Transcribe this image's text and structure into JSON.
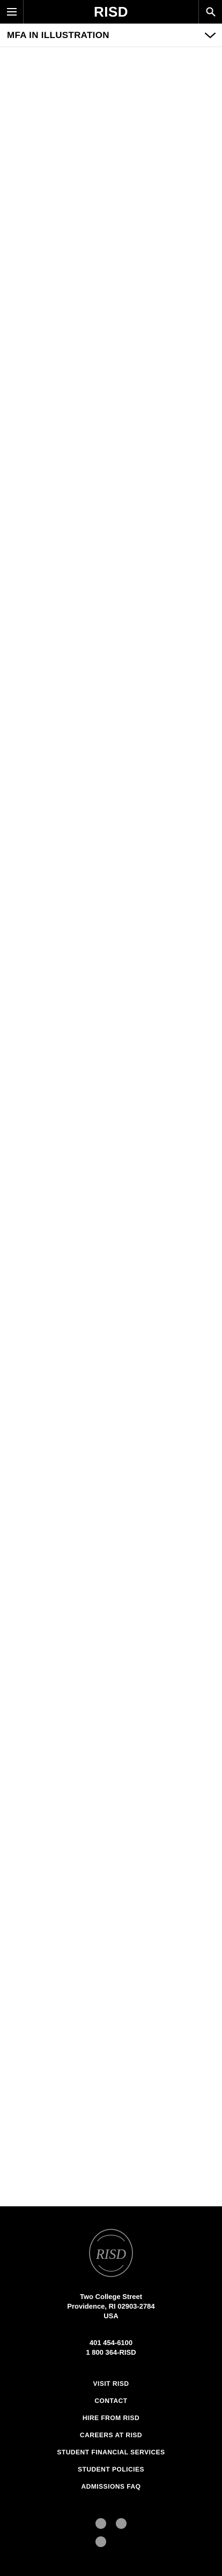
{
  "header": {
    "logo": "RISD",
    "menu_icon": "hamburger-menu-icon",
    "search_icon": "search-icon"
  },
  "subnav": {
    "title": "MFA IN ILLUSTRATION",
    "toggle_icon": "chevron-down-icon"
  },
  "footer": {
    "seal_text": "RISD",
    "address": {
      "line1": "Two College Street",
      "line2": "Providence, RI 02903-2784",
      "line3": "USA"
    },
    "phone1": "401 454-6100",
    "phone2": "1 800 364-RISD",
    "links": [
      {
        "label": "VISIT RISD"
      },
      {
        "label": "CONTACT"
      },
      {
        "label": "HIRE FROM RISD"
      },
      {
        "label": "CAREERS AT RISD"
      },
      {
        "label": "STUDENT FINANCIAL SERVICES"
      },
      {
        "label": "STUDENT POLICIES"
      },
      {
        "label": "ADMISSIONS FAQ"
      }
    ],
    "socials": [
      {
        "icon": "social-icon-1"
      },
      {
        "icon": "social-icon-2"
      },
      {
        "icon": "social-icon-3"
      }
    ]
  },
  "colors": {
    "header_bg": "#000000",
    "footer_bg": "#000000",
    "text_on_dark": "#ffffff",
    "social_icon": "#9a9a9a"
  }
}
